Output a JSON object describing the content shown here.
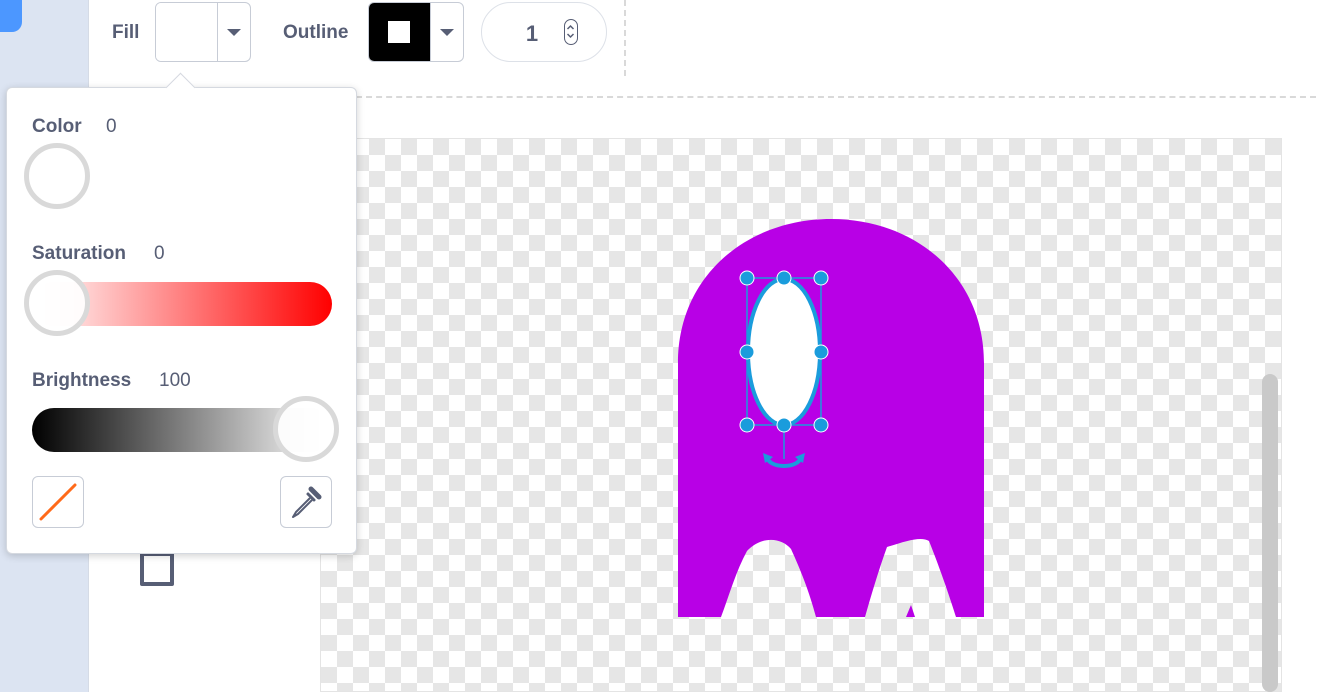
{
  "toolbar": {
    "fill_label": "Fill",
    "outline_label": "Outline",
    "stroke_width": "1",
    "fill_color": "#ffffff",
    "outline_color": "#000000"
  },
  "color_popover": {
    "color_label": "Color",
    "color_value": "0",
    "saturation_label": "Saturation",
    "saturation_value": "0",
    "brightness_label": "Brightness",
    "brightness_value": "100",
    "no_fill_icon": "diagonal-slash-icon",
    "eyedropper_icon": "eyedropper-icon"
  },
  "canvas": {
    "shape_color": "#b800e6",
    "selection_color": "#1a9cdc",
    "selected_shape": "ellipse"
  },
  "tools": {
    "rectangle_icon": "rectangle-icon"
  }
}
